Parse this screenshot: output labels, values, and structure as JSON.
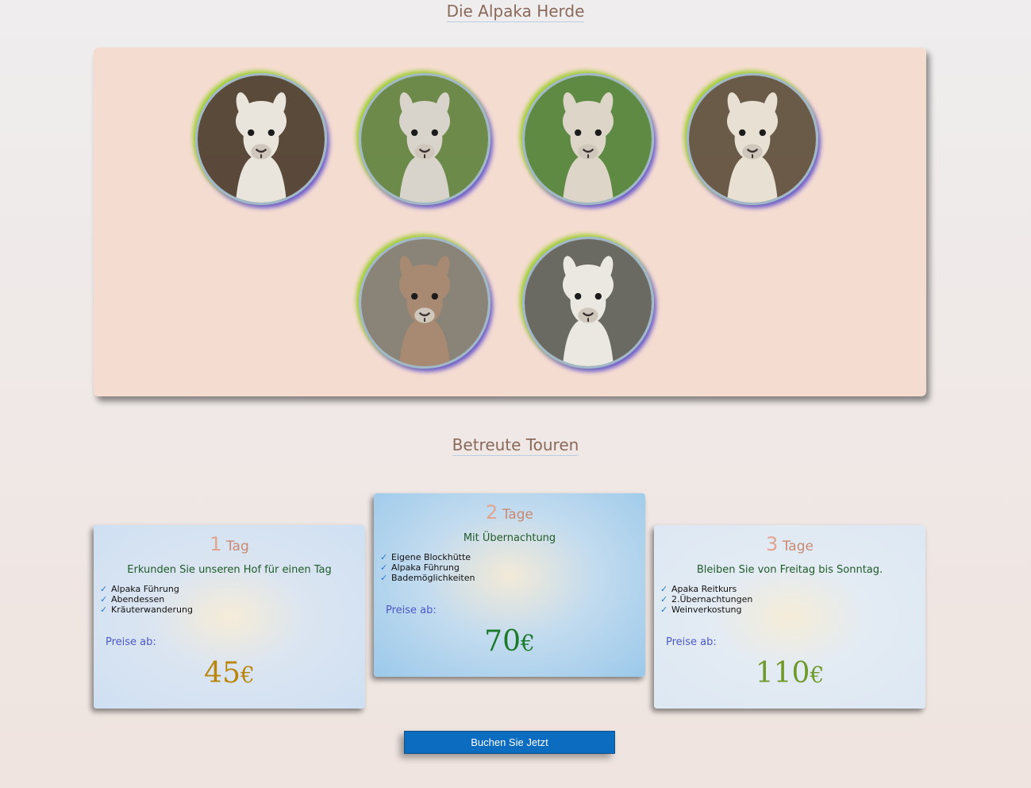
{
  "herd": {
    "title": "Die Alpaka Herde",
    "alpacas": [
      {
        "name": "alpaca-photo-1",
        "bg": "#5a4a3a",
        "fur": "#e9e4dc"
      },
      {
        "name": "alpaca-photo-2",
        "bg": "#6d8a4a",
        "fur": "#d8d4cc"
      },
      {
        "name": "alpaca-photo-3",
        "bg": "#5f8a44",
        "fur": "#ddd6c8"
      },
      {
        "name": "alpaca-photo-4",
        "bg": "#6a5a48",
        "fur": "#e8e0d2"
      },
      {
        "name": "alpaca-photo-5",
        "bg": "#8a8478",
        "fur": "#a88a72"
      },
      {
        "name": "alpaca-photo-6",
        "bg": "#6a6a62",
        "fur": "#ebe8e2"
      }
    ]
  },
  "tours": {
    "title": "Betreute Touren",
    "cards": [
      {
        "num": "1",
        "unit": "Tag",
        "subtitle": "Erkunden Sie unseren Hof für einen Tag",
        "features": [
          "Alpaka Führung",
          "Abendessen",
          "Kräuterwanderung"
        ],
        "price_label": "Preise ab:",
        "price": "45",
        "currency": "€"
      },
      {
        "num": "2",
        "unit": "Tage",
        "subtitle": "Mit Übernachtung",
        "features": [
          "Eigene Blockhütte",
          "Alpaka Führung",
          "Bademöglichkeiten"
        ],
        "price_label": "Preise ab:",
        "price": "70",
        "currency": "€"
      },
      {
        "num": "3",
        "unit": "Tage",
        "subtitle": "Bleiben Sie von Freitag bis Sonntag.",
        "features": [
          "Apaka Reitkurs",
          "2.Übernachtungen",
          "Weinverkostung"
        ],
        "price_label": "Preise ab:",
        "price": "110",
        "currency": "€"
      }
    ],
    "check_icon": "check-icon"
  },
  "book_button": "Buchen Sie Jetzt"
}
